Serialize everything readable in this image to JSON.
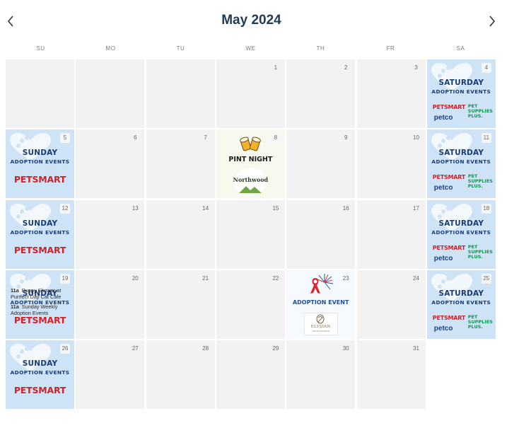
{
  "header": {
    "title": "May 2024",
    "prev_icon": "chevron-left-icon",
    "next_icon": "chevron-right-icon"
  },
  "weekdays": [
    "SU",
    "MO",
    "TU",
    "WE",
    "TH",
    "FR",
    "SA"
  ],
  "colors": {
    "title": "#1f3b57",
    "cell_bg": "#f2f2f2",
    "promo_bg": "#cfe3f6",
    "promo_text": "#173b78",
    "petsmart_red": "#d32027",
    "petco_blue": "#1b3e84",
    "pet_supplies_green": "#0b9a4a"
  },
  "promo": {
    "sunday": {
      "line1": "SUNDAY",
      "line2": "ADOPTION EVENTS",
      "logo": "PETSMART"
    },
    "saturday": {
      "line1": "SATURDAY",
      "line2": "ADOPTION EVENTS",
      "logo1": "PETSMART",
      "logo2": "petco",
      "logo3a": "PET",
      "logo3b": "SUPPLIES",
      "logo3c": "PLUS."
    }
  },
  "pint_night": {
    "title": "PINT NIGHT",
    "brand": "Northwood"
  },
  "adoption_event": {
    "title": "ADOPTION EVENT",
    "brand": "ELYSIAN",
    "brand_sub": "SALON STUDIOS"
  },
  "events_19": [
    {
      "time": "11a",
      "title": "Puppy Shower at Purrfect Day Cat Cafe"
    },
    {
      "time": "11a",
      "title": "Sunday Weekly Adoption Events"
    }
  ],
  "weeks": [
    [
      "",
      "",
      "",
      "1",
      "2",
      "3",
      "4"
    ],
    [
      "5",
      "6",
      "7",
      "8",
      "9",
      "10",
      "11"
    ],
    [
      "12",
      "13",
      "14",
      "15",
      "16",
      "17",
      "18"
    ],
    [
      "19",
      "20",
      "21",
      "22",
      "23",
      "24",
      "25"
    ],
    [
      "26",
      "27",
      "28",
      "29",
      "30",
      "31",
      ""
    ]
  ]
}
